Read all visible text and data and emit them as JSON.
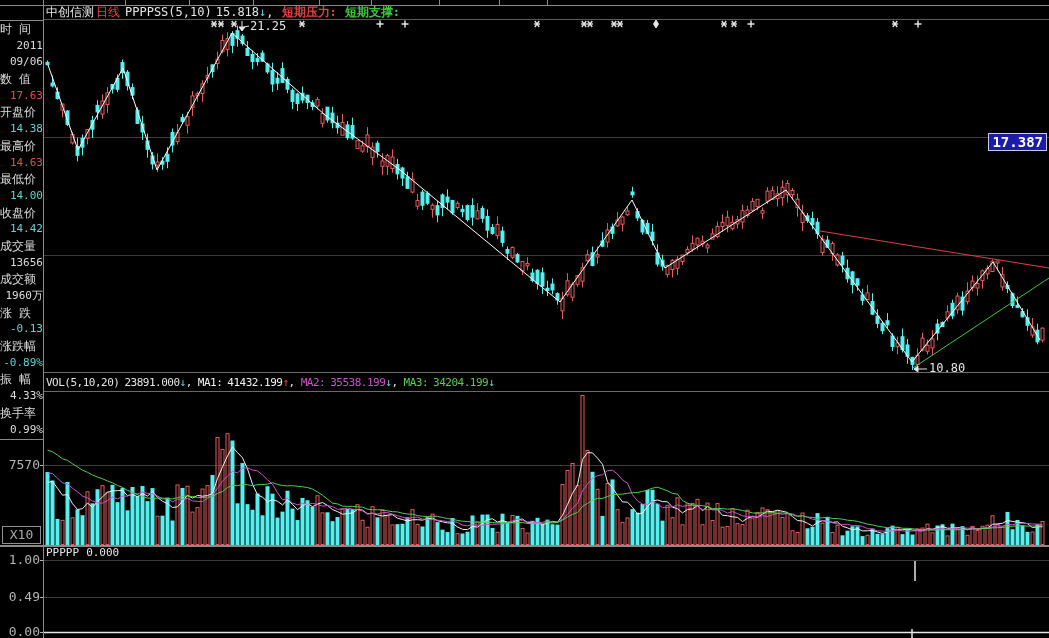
{
  "main_header": {
    "stock": "中创信测",
    "period": "日线",
    "formula": "PPPPSS(5,10)",
    "value": "15.818",
    "arrow": "↓",
    "rising": false,
    "separator": ",",
    "lines": [
      {
        "label": "短期压力:",
        "color": "#e04040"
      },
      {
        "label": "短期支撑:",
        "color": "#3cc83c"
      }
    ]
  },
  "price_labels": {
    "peak": "21.25",
    "trough": "10.80",
    "latest": "17.387"
  },
  "info_panel": [
    {
      "label": "时 间",
      "values": [
        "2011",
        "09/06"
      ],
      "color": "#dcdcdc"
    },
    {
      "label": "数 值",
      "values": [
        "17.63"
      ],
      "color": "#d9534f"
    },
    {
      "label": "开盘价",
      "values": [
        "14.38"
      ],
      "color": "#5cd6d6"
    },
    {
      "label": "最高价",
      "values": [
        "14.63"
      ],
      "color": "#d9534f"
    },
    {
      "label": "最低价",
      "values": [
        "14.00"
      ],
      "color": "#5cd6d6"
    },
    {
      "label": "收盘价",
      "values": [
        "14.42"
      ],
      "color": "#5cd6d6"
    },
    {
      "label": "成交量",
      "values": [
        "13656"
      ],
      "color": "#dcdcdc"
    },
    {
      "label": "成交额",
      "values": [
        "1960万"
      ],
      "color": "#dcdcdc"
    },
    {
      "label": "涨 跌",
      "values": [
        "-0.13"
      ],
      "color": "#5cd6d6"
    },
    {
      "label": "涨跌幅",
      "values": [
        "-0.89%"
      ],
      "color": "#5cd6d6"
    },
    {
      "label": "振 幅",
      "values": [
        "4.33%"
      ],
      "color": "#dcdcdc"
    },
    {
      "label": "换手率",
      "values": [
        "0.99%"
      ],
      "color": "#dcdcdc"
    }
  ],
  "volume_panel": {
    "name": "VOL(5,10,20)",
    "value": "23891.000",
    "arrow": "↓",
    "rising": false,
    "separator": ",",
    "averages": [
      {
        "label": "MA1:",
        "value": "41432.199",
        "arrow": "↑",
        "rising": true,
        "separator": ",",
        "color": "#f2f2f2"
      },
      {
        "label": "MA2:",
        "value": "35538.199",
        "arrow": "↓",
        "rising": false,
        "separator": ",",
        "color": "#d050d0"
      },
      {
        "label": "MA3:",
        "value": "34204.199",
        "arrow": "↓",
        "rising": false,
        "color": "#50d050"
      }
    ],
    "axis_label": "7570",
    "scale": "X10"
  },
  "indicator_panel": {
    "name": "PPPPP",
    "value": "0.000",
    "axis_labels": [
      "1.00",
      "0.49",
      "0.00"
    ]
  }
}
